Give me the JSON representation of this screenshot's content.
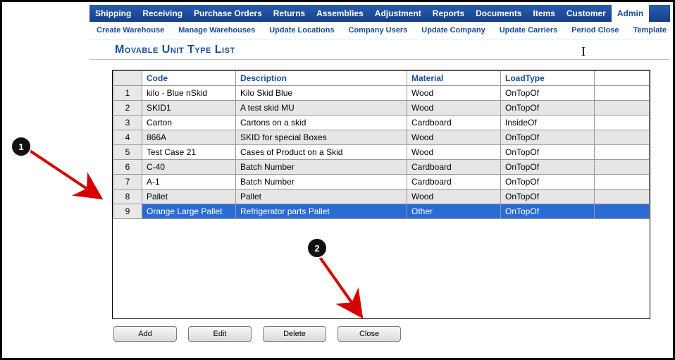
{
  "mainmenu": {
    "items": [
      "Shipping",
      "Receiving",
      "Purchase Orders",
      "Returns",
      "Assemblies",
      "Adjustment",
      "Reports",
      "Documents",
      "Items",
      "Customer",
      "Admin"
    ],
    "active": "Admin"
  },
  "submenu": {
    "items": [
      "Create Warehouse",
      "Manage Warehouses",
      "Update Locations",
      "Company Users",
      "Update Company",
      "Update Carriers",
      "Period Close",
      "Template"
    ]
  },
  "page": {
    "title": "Movable Unit Type List"
  },
  "table": {
    "columns": [
      "Code",
      "Description",
      "Material",
      "LoadType"
    ],
    "selected_index": 8,
    "rows": [
      {
        "n": 1,
        "code": "kilo - Blue nSkid",
        "description": "Kilo Skid Blue",
        "material": "Wood",
        "loadtype": "OnTopOf"
      },
      {
        "n": 2,
        "code": "SKID1",
        "description": "A test skid MU",
        "material": "Wood",
        "loadtype": "OnTopOf"
      },
      {
        "n": 3,
        "code": "Carton",
        "description": "Cartons on a skid",
        "material": "Cardboard",
        "loadtype": "InsideOf"
      },
      {
        "n": 4,
        "code": "866A",
        "description": "SKID for special Boxes",
        "material": "Wood",
        "loadtype": "OnTopOf"
      },
      {
        "n": 5,
        "code": "Test Case 21",
        "description": "Cases of Product on a Skid",
        "material": "Wood",
        "loadtype": "OnTopOf"
      },
      {
        "n": 6,
        "code": "C-40",
        "description": "Batch Number",
        "material": "Cardboard",
        "loadtype": "OnTopOf"
      },
      {
        "n": 7,
        "code": "A-1",
        "description": "Batch Number",
        "material": "Cardboard",
        "loadtype": "OnTopOf"
      },
      {
        "n": 8,
        "code": "Pallet",
        "description": "Pallet",
        "material": "Wood",
        "loadtype": "OnTopOf"
      },
      {
        "n": 9,
        "code": "Orange Large Pallet",
        "description": "Refrigerator parts Pallet",
        "material": "Other",
        "loadtype": "OnTopOf"
      }
    ]
  },
  "buttons": {
    "add": "Add",
    "edit": "Edit",
    "delete": "Delete",
    "close": "Close"
  },
  "annotations": [
    "1",
    "2"
  ]
}
